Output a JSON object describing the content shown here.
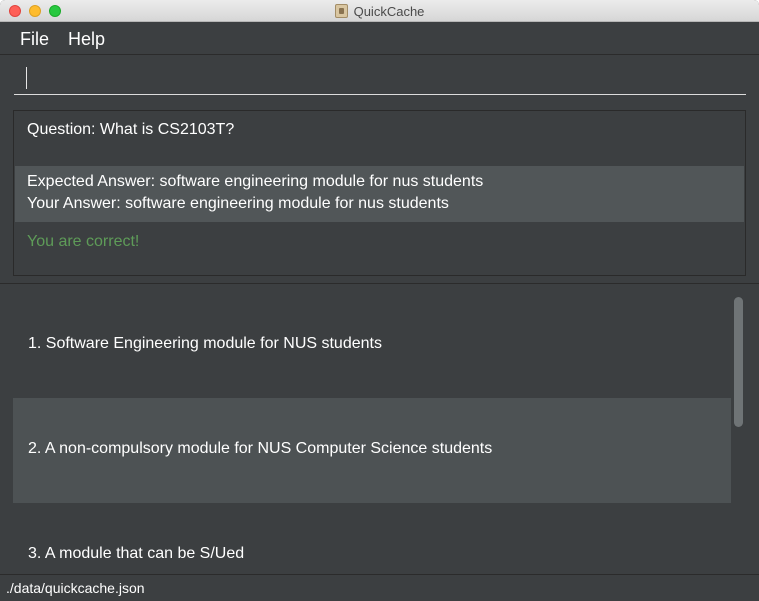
{
  "window": {
    "title": "QuickCache",
    "app_icon": "quickcache-app-icon"
  },
  "menu": {
    "file_label": "File",
    "help_label": "Help"
  },
  "command": {
    "value": "",
    "placeholder": ""
  },
  "result": {
    "question": "Question: What is CS2103T?",
    "expected_answer": "Expected Answer: software engineering module for nus students",
    "your_answer": "Your Answer: software engineering module for nus students",
    "feedback": "You are correct!",
    "feedback_color": "#5e9b58"
  },
  "options": {
    "items": [
      {
        "label": "1.  Software Engineering module for NUS students"
      },
      {
        "label": "2.  A non-compulsory module for NUS Computer Science students"
      },
      {
        "label": "3.  A module that can be S/Ued"
      }
    ]
  },
  "status": {
    "file_path": "./data/quickcache.json"
  }
}
